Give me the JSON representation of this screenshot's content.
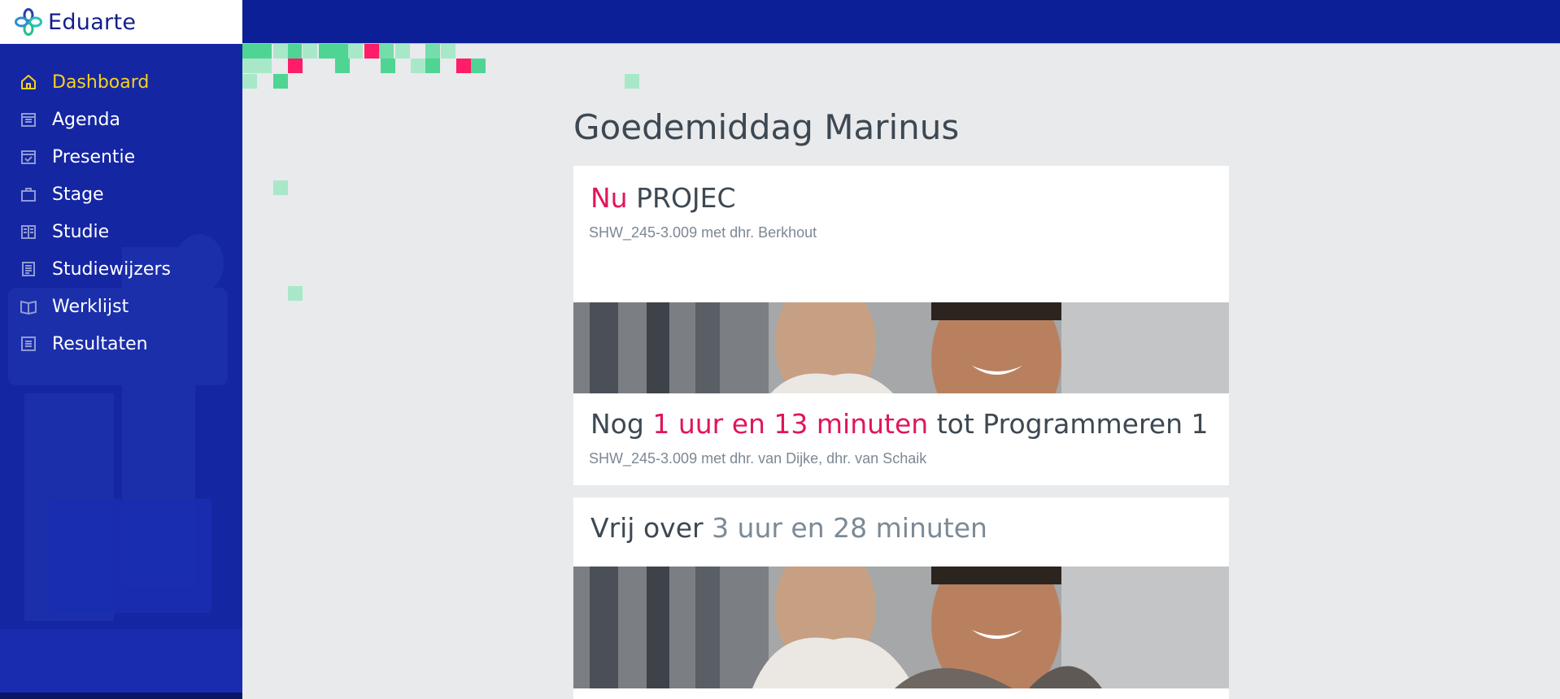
{
  "app": {
    "name": "Eduarte",
    "logo_icon": "eduarte-flower-logo"
  },
  "colors": {
    "brand_blue": "#0c1f96",
    "sidebar_blue": "#1526a3",
    "active_yellow": "#f7d11d",
    "accent_pink": "#e0165a",
    "pixel_green": "#4fd494"
  },
  "sidebar": {
    "items": [
      {
        "label": "Dashboard",
        "icon": "home-icon",
        "active": true
      },
      {
        "label": "Agenda",
        "icon": "calendar-icon",
        "active": false
      },
      {
        "label": "Presentie",
        "icon": "calendar-check-icon",
        "active": false
      },
      {
        "label": "Stage",
        "icon": "briefcase-icon",
        "active": false
      },
      {
        "label": "Studie",
        "icon": "book-columns-icon",
        "active": false
      },
      {
        "label": "Studiewijzers",
        "icon": "document-list-icon",
        "active": false
      },
      {
        "label": "Werklijst",
        "icon": "open-book-icon",
        "active": false
      },
      {
        "label": "Resultaten",
        "icon": "list-icon",
        "active": false
      }
    ]
  },
  "main": {
    "greeting": "Goedemiddag Marinus",
    "now_card": {
      "prefix": "Nu",
      "title": "PROJEC",
      "subtitle": "SHW_245-3.009 met dhr. Berkhout"
    },
    "next_card": {
      "prefix": "Nog",
      "countdown": "1 uur en 13 minuten",
      "middle": "tot",
      "title": "Programmeren 1",
      "subtitle": "SHW_245-3.009 met dhr. van Dijke, dhr. van Schaik"
    },
    "free_card": {
      "prefix": "Vrij over",
      "countdown": "3 uur en 28 minuten"
    }
  }
}
